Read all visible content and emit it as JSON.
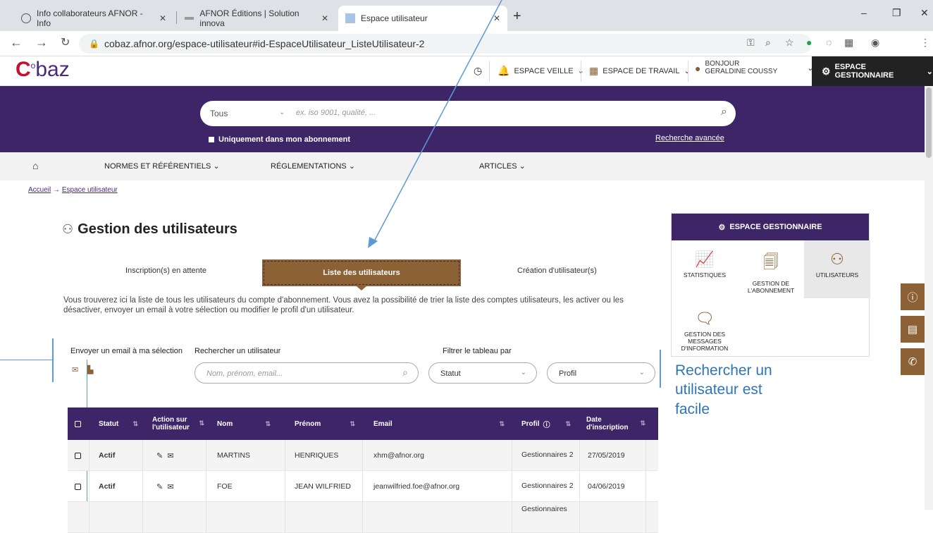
{
  "browser": {
    "tabs": [
      {
        "title": "Info collaborateurs AFNOR - Info",
        "close": "✕"
      },
      {
        "title": "AFNOR Éditions | Solution innova",
        "close": "✕"
      },
      {
        "title": "Espace utilisateur",
        "close": "✕"
      }
    ],
    "new_tab": "+",
    "url": "cobaz.afnor.org/espace-utilisateur#id-EspaceUtilisateur_ListeUtilisateur-2",
    "controls": {
      "minimize": "–",
      "maximize": "❐",
      "close": "✕"
    }
  },
  "site": {
    "logo": "CObaz",
    "header": {
      "history_icon": "history-icon",
      "veille": "ESPACE VEILLE",
      "travail": "ESPACE DE TRAVAIL",
      "bonjour": "BONJOUR",
      "user": "GERALDINE COUSSY",
      "gestionnaire": "ESPACE GESTIONNAIRE"
    },
    "search": {
      "scope": "Tous",
      "placeholder": "ex. iso 9001, qualité, ...",
      "only_subscription": "Uniquement dans mon abonnement",
      "advanced": "Recherche avancée"
    },
    "menu": [
      "NORMES ET RÉFÉRENTIELS",
      "RÉGLEMENTATIONS",
      "ARTICLES"
    ],
    "breadcrumb": {
      "home": "Accueil",
      "sep": "→",
      "current": "Espace utilisateur"
    }
  },
  "page": {
    "title": "Gestion des utilisateurs",
    "tabs": [
      "Inscription(s) en attente",
      "Liste des utilisateurs",
      "Création d'utilisateur(s)"
    ],
    "intro": "Vous trouverez ici la liste de tous les utilisateurs du compte d'abonnement. Vous avez la possibilité de trier la liste des comptes utilisateurs, les activer ou les désactiver, envoyer un email à votre sélection ou modifier le profil d'un utilisateur.",
    "send_email_label": "Envoyer un email à ma sélection",
    "search_user_label": "Rechercher un utilisateur",
    "search_user_placeholder": "Nom, prénom, email...",
    "filter_label": "Filtrer le tableau par",
    "filter_status": "Statut",
    "filter_profile": "Profil"
  },
  "annotation": {
    "line1": "Rechercher un",
    "line2": "utilisateur est",
    "line3": "facile"
  },
  "table": {
    "headers": {
      "statut": "Statut",
      "action": "Action sur l'utilisateur",
      "nom": "Nom",
      "prenom": "Prénom",
      "email": "Email",
      "profil": "Profil",
      "date": "Date d'inscription"
    },
    "rows": [
      {
        "statut": "Actif",
        "nom": "MARTINS",
        "prenom": "HENRIQUES",
        "email": "xhm@afnor.org",
        "profil": "Gestionnaires 2",
        "date": "27/05/2019"
      },
      {
        "statut": "Actif",
        "nom": "FOE",
        "prenom": "JEAN WILFRIED",
        "email": "jeanwilfried.foe@afnor.org",
        "profil": "Gestionnaires 2",
        "date": "04/06/2019"
      },
      {
        "statut": "",
        "nom": "",
        "prenom": "",
        "email": "",
        "profil": "Gestionnaires",
        "date": ""
      }
    ]
  },
  "sidebar": {
    "title": "ESPACE GESTIONNAIRE",
    "tiles": [
      "STATISTIQUES",
      "GESTION DE L'ABONNEMENT",
      "UTILISATEURS",
      "GESTION DES MESSAGES D'INFORMATION"
    ]
  },
  "colors": {
    "purple": "#3e2567",
    "brown": "#8b6135",
    "annotation_blue": "#2e75b6"
  }
}
